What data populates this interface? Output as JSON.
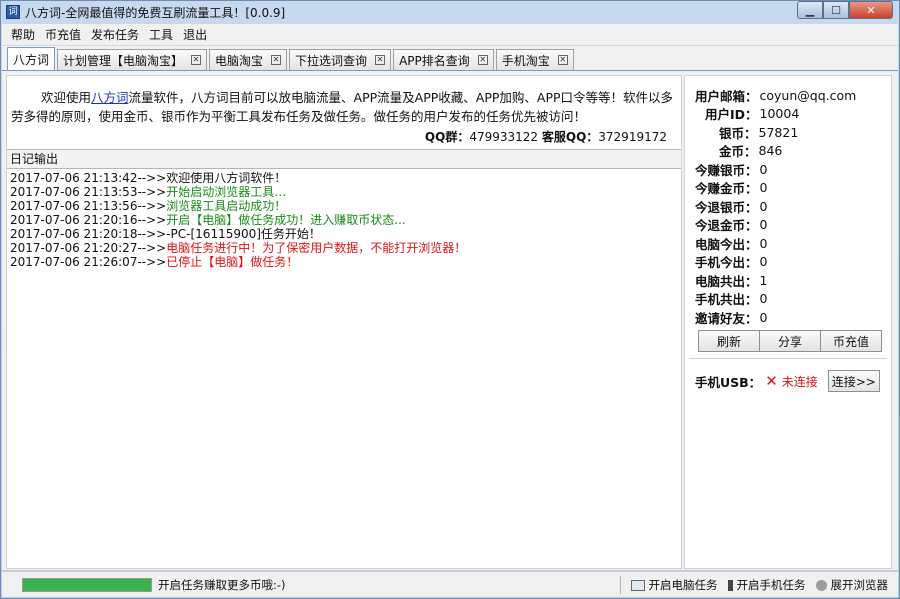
{
  "window": {
    "title": "八方词-全网最值得的免费互刷流量工具！[0.0.9]",
    "icon_glyph": "词"
  },
  "menu": [
    "帮助",
    "币充值",
    "发布任务",
    "工具",
    "退出"
  ],
  "tabs": [
    {
      "label": "八方词",
      "active": true,
      "closable": false
    },
    {
      "label": "计划管理【电脑淘宝】",
      "active": false,
      "closable": true
    },
    {
      "label": "电脑淘宝",
      "active": false,
      "closable": true
    },
    {
      "label": "下拉选词查询",
      "active": false,
      "closable": true
    },
    {
      "label": "APP排名查询",
      "active": false,
      "closable": true
    },
    {
      "label": "手机淘宝",
      "active": false,
      "closable": true
    }
  ],
  "welcome": {
    "prefix": "欢迎使用",
    "link": "八方词",
    "body": "流量软件，八方词目前可以放电脑流量、APP流量及APP收藏、APP加购、APP口令等等！软件以多劳多得的原则，使用金币、银币作为平衡工具发布任务及做任务。做任务的用户发布的任务优先被访问！",
    "qq_group_label": "QQ群：",
    "qq_group": "479933122",
    "service_label": "客服QQ：",
    "service_qq": "372919172"
  },
  "log": {
    "header": "日记输出",
    "lines": [
      {
        "ts": "2017-07-06 21:13:42-->>",
        "msg": "欢迎使用八方词软件！",
        "color": "#111111"
      },
      {
        "ts": "2017-07-06 21:13:53-->>",
        "msg": "开始启动浏览器工具…",
        "color": "#1a8a1a"
      },
      {
        "ts": "2017-07-06 21:13:56-->>",
        "msg": "浏览器工具启动成功！",
        "color": "#1a8a1a"
      },
      {
        "ts": "2017-07-06 21:20:16-->>",
        "msg": "开启【电脑】做任务成功！进入赚取币状态...",
        "color": "#1a8a1a"
      },
      {
        "ts": "2017-07-06 21:20:18-->>",
        "msg": "-PC-[16115900]任务开始！",
        "color": "#111111"
      },
      {
        "ts": "2017-07-06 21:20:27-->>",
        "msg": "电脑任务进行中！为了保密用户数据，不能打开浏览器！",
        "color": "#e01414"
      },
      {
        "ts": "2017-07-06 21:26:07-->>",
        "msg": "已停止【电脑】做任务！",
        "color": "#e01414"
      }
    ]
  },
  "stats": [
    {
      "label": "用户邮箱：",
      "value": "coyun@qq.com",
      "indent": 0
    },
    {
      "label": "用户ID：",
      "value": "10004",
      "indent": 1
    },
    {
      "label": "银币：",
      "value": "57821",
      "indent": 2
    },
    {
      "label": "金币：",
      "value": "846",
      "indent": 2
    },
    {
      "label": "今赚银币：",
      "value": "0",
      "indent": 0
    },
    {
      "label": "今赚金币：",
      "value": "0",
      "indent": 0
    },
    {
      "label": "今退银币：",
      "value": "0",
      "indent": 0
    },
    {
      "label": "今退金币：",
      "value": "0",
      "indent": 0
    },
    {
      "label": "电脑今出：",
      "value": "0",
      "indent": 0
    },
    {
      "label": "手机今出：",
      "value": "0",
      "indent": 0
    },
    {
      "label": "电脑共出：",
      "value": "1",
      "indent": 0
    },
    {
      "label": "手机共出：",
      "value": "0",
      "indent": 0
    },
    {
      "label": "邀请好友：",
      "value": "0",
      "indent": 0
    }
  ],
  "actions": {
    "refresh": "刷新",
    "share": "分享",
    "recharge": "币充值"
  },
  "usb": {
    "label": "手机USB：",
    "status_icon": "✕",
    "status": "未连接",
    "connect": "连接>>"
  },
  "statusbar": {
    "progress_percent": 100,
    "hint": "开启任务赚取更多币哦:-)",
    "pc_task": "开启电脑任务",
    "phone_task": "开启手机任务",
    "browser": "展开浏览器"
  }
}
